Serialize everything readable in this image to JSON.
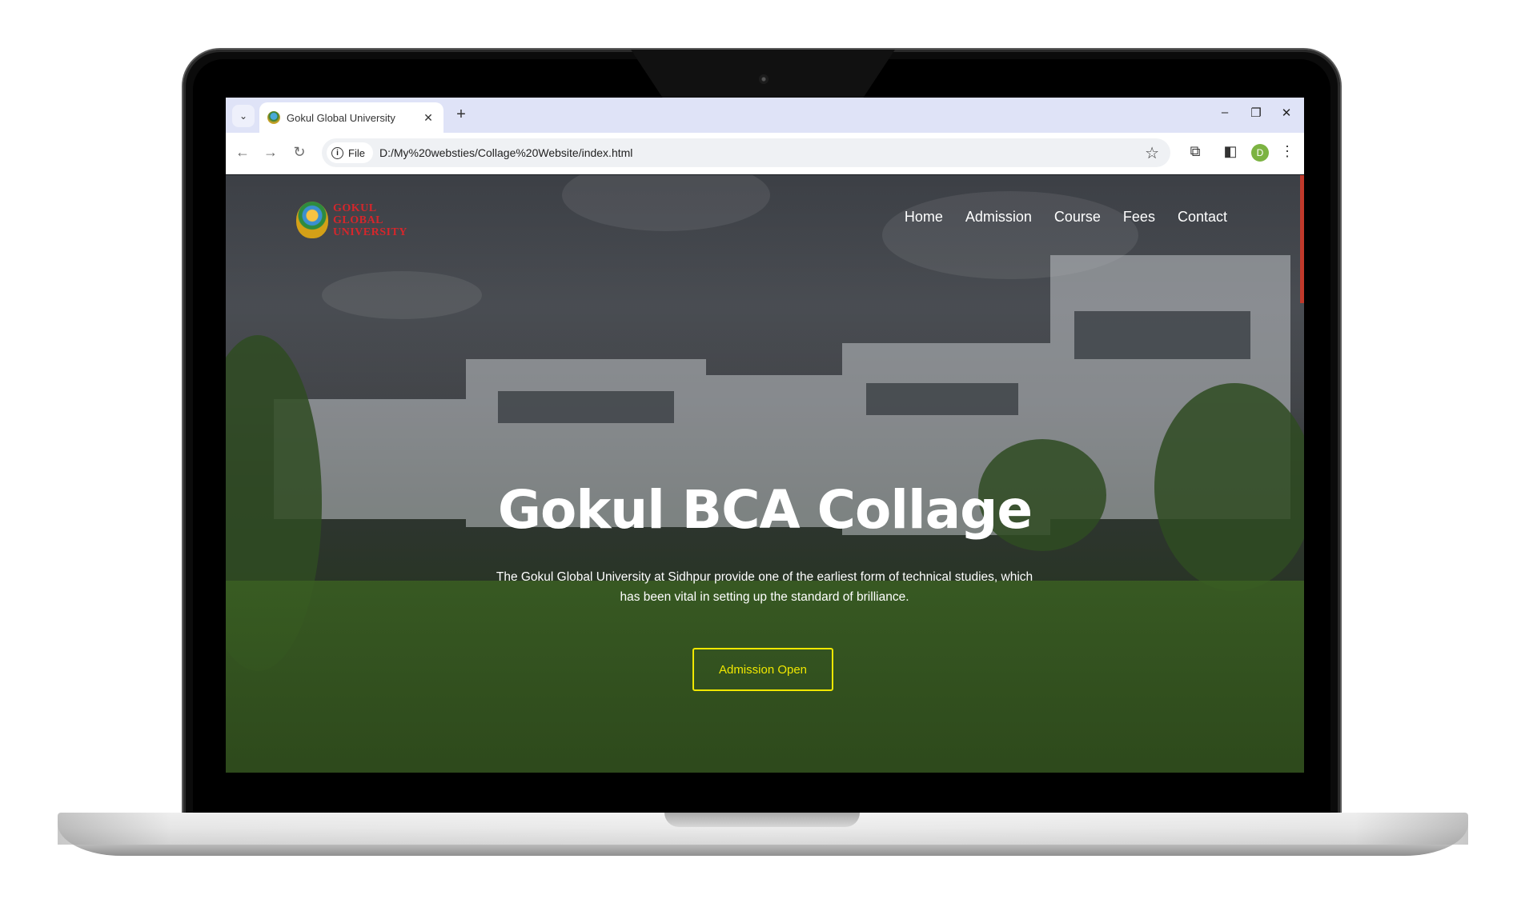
{
  "browser": {
    "tab": {
      "title": "Gokul Global University",
      "close_glyph": "✕"
    },
    "tab_list_glyph": "⌄",
    "new_tab_glyph": "+",
    "window_controls": {
      "minimize": "–",
      "restore": "❐",
      "close": "✕"
    },
    "nav": {
      "back": "←",
      "forward": "→",
      "reload": "↻"
    },
    "address_bar": {
      "scheme_label": "File",
      "info_glyph": "i",
      "url": "D:/My%20websties/Collage%20Website/index.html",
      "star_glyph": "☆"
    },
    "toolbar_icons": {
      "extensions": "⧉",
      "side_panel": "◧",
      "menu": "⋮"
    },
    "profile_initial": "D"
  },
  "site": {
    "logo_lines": [
      "GOKUL",
      "GLOBAL",
      "UNIVERSITY"
    ],
    "nav_links": [
      "Home",
      "Admission",
      "Course",
      "Fees",
      "Contact"
    ],
    "hero": {
      "title": "Gokul BCA Collage",
      "description": "The Gokul Global University at Sidhpur provide one of the earliest form of technical studies, which has been vital in setting up the standard of brilliance.",
      "cta_label": "Admission Open"
    }
  },
  "colors": {
    "tab_strip": "#dfe3f7",
    "cta_accent": "#f0e800",
    "logo_red": "#d6262b",
    "scroll_accent": "#c0392b"
  }
}
